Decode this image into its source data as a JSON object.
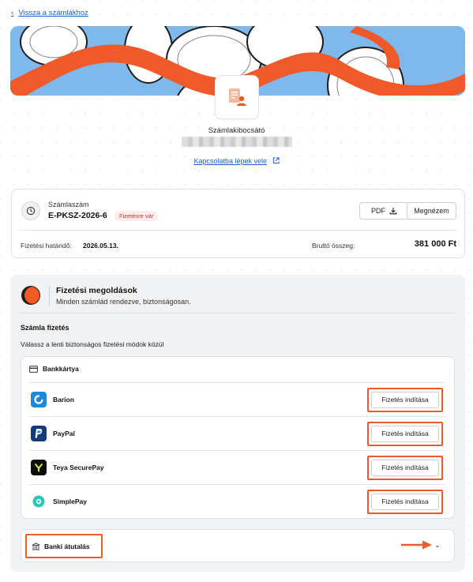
{
  "nav": {
    "back_label": "Vissza a számlákhoz"
  },
  "issuer": {
    "label": "Számlakibocsátó",
    "contact_link": "Kapcsolatba lépek vele"
  },
  "invoice": {
    "number_label": "Számlaszám",
    "number": "E-PKSZ-2026-6",
    "status": "Fizetésre vár",
    "pdf_label": "PDF",
    "view_label": "Megnézem",
    "due_label": "Fizetési határidő:",
    "due_value": "2026.05.13.",
    "gross_label": "Bruttó összeg:",
    "gross_value": "381 000 Ft"
  },
  "payment": {
    "title": "Fizetési megoldások",
    "subtitle": "Minden számlád rendezve, biztonságosan.",
    "section_title": "Számla fizetés",
    "section_subtitle": "Válassz a lenti biztonságos fizetési módok közül",
    "card_group_label": "Bankkártya",
    "methods": [
      {
        "name": "Barion",
        "button": "Fizetés indítása",
        "icon": "barion-logo",
        "color": "#1c8ad9"
      },
      {
        "name": "PayPal",
        "button": "Fizetés indítása",
        "icon": "paypal-logo",
        "color": "#143b7a"
      },
      {
        "name": "Teya SecurePay",
        "button": "Fizetés indítása",
        "icon": "teya-logo",
        "color": "#0d0d0d"
      },
      {
        "name": "SimplePay",
        "button": "Fizetés indítása",
        "icon": "simplepay-logo",
        "color": "#2bc6b5"
      }
    ],
    "bank_transfer_label": "Banki átutalás"
  },
  "colors": {
    "accent_highlight": "#ea5b2a",
    "link": "#1f5fd0",
    "banner_sky": "#7fb8ea",
    "banner_ribbon": "#f05a2b"
  }
}
